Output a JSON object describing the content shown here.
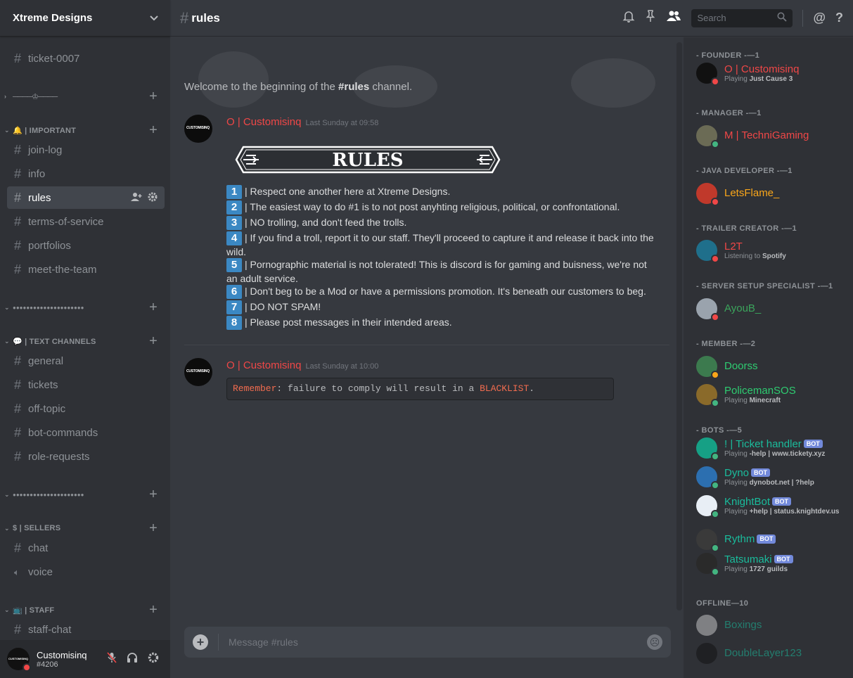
{
  "server": {
    "name": "Xtreme Designs",
    "chevron_icon": "chevron-down-icon"
  },
  "channels": {
    "top": [
      {
        "name": "ticket-0007",
        "locked": true
      }
    ],
    "categories": [
      {
        "id": "divider1",
        "label": "────♔────",
        "collapsed": true
      },
      {
        "id": "important",
        "label": "🔔 | IMPORTANT",
        "channels": [
          "join-log",
          "info",
          "rules",
          "terms-of-service",
          "portfolios",
          "meet-the-team"
        ]
      },
      {
        "id": "divider2",
        "label": "●●●●●●●●●●●●●●●●●●●●●",
        "collapsed": true
      },
      {
        "id": "text",
        "label": "💬 | TEXT CHANNELS",
        "channels": [
          "general",
          "tickets",
          "off-topic",
          "bot-commands",
          "role-requests"
        ]
      },
      {
        "id": "divider3",
        "label": "●●●●●●●●●●●●●●●●●●●●●",
        "collapsed": true
      },
      {
        "id": "sellers",
        "label": "$ | SELLERS",
        "channels": [
          "chat",
          "voice"
        ]
      },
      {
        "id": "staff",
        "label": "📺 | STAFF",
        "channels": [
          "staff-chat"
        ]
      }
    ],
    "active": "rules"
  },
  "user": {
    "name": "Customisinq",
    "tag": "#4206",
    "avatar_label": "CUSTOMISINQ",
    "status_color": "#f04747"
  },
  "topbar": {
    "channel": "rules",
    "search_placeholder": "Search",
    "icons": [
      "bell-icon",
      "pin-icon",
      "members-icon",
      "search-icon",
      "mention-icon",
      "help-icon"
    ]
  },
  "chat": {
    "welcome_prefix": "Welcome to the beginning of the ",
    "welcome_channel": "#rules",
    "welcome_suffix": " channel.",
    "messages": [
      {
        "author": "O | Customisinq",
        "time": "Last Sunday at 09:58",
        "banner_text": "RULES",
        "rules": [
          {
            "n": "1",
            "text": "| Respect one another here at Xtreme Designs."
          },
          {
            "n": "2",
            "text": "|  The easiest way to do #1 is to not post anyhting religious, political, or confrontational."
          },
          {
            "n": "3",
            "text": "| NO trolling, and don't feed the trolls."
          },
          {
            "n": "4",
            "text": "| If you find a troll, report it to our staff. They'll proceed to capture it and release it back into the wild."
          },
          {
            "n": "5",
            "text": "| Pornographic material is not tolerated! This is discord is for gaming and buisness, we're not an adult service."
          },
          {
            "n": "6",
            "text": "| Don't beg to be a Mod or have a permissions promotion. It's beneath our customers to beg."
          },
          {
            "n": "7",
            "text": "| DO NOT SPAM!"
          },
          {
            "n": "8",
            "text": "| Please post messages in their intended areas."
          }
        ]
      },
      {
        "author": "O | Customisinq",
        "time": "Last Sunday at 10:00",
        "code_kw1": "Remember",
        "code_mid": ": failure to comply will result in a ",
        "code_kw2": "BLACKLIST",
        "code_end": "."
      }
    ],
    "input_placeholder": "Message #rules"
  },
  "members": {
    "groups": [
      {
        "title": "- FOUNDER -—1",
        "members": [
          {
            "name": "O | Customisinq",
            "color": "#f04747",
            "status": "#f04747",
            "activity": "Playing ",
            "activity_b": "Just Cause 3",
            "av": "#111111"
          }
        ]
      },
      {
        "title": "- MANAGER -—1",
        "members": [
          {
            "name": "M | TechniGaming",
            "color": "#f04747",
            "status": "#43b581",
            "av": "#6b6b55"
          }
        ]
      },
      {
        "title": "- JAVA DEVELOPER -—1",
        "members": [
          {
            "name": "LetsFlame_",
            "color": "#faa61a",
            "status": "#f04747",
            "av": "#c0392b"
          }
        ]
      },
      {
        "title": "- TRAILER CREATOR -—1",
        "members": [
          {
            "name": "L2T",
            "color": "#f04747",
            "status": "#f04747",
            "activity": "Listening to ",
            "activity_b": "Spotify",
            "av": "#1f6f8b"
          }
        ]
      },
      {
        "title": "- SERVER SETUP SPECIALIST -—1",
        "members": [
          {
            "name": "AyouB_",
            "color": "#3ba55c",
            "status": "#f04747",
            "av": "#9aa3ad"
          }
        ]
      },
      {
        "title": "- MEMBER -—2",
        "members": [
          {
            "name": "Doorss",
            "color": "#2ecc71",
            "status": "#faa61a",
            "av": "#3c7a4e"
          },
          {
            "name": "PolicemanSOS",
            "color": "#2ecc71",
            "status": "#43b581",
            "activity": "Playing ",
            "activity_b": "Minecraft",
            "av": "#8a6a2a"
          }
        ]
      },
      {
        "title": "- BOTS -—5",
        "members": [
          {
            "name": "! | Ticket handler",
            "color": "#1abc9c",
            "status": "#43b581",
            "bot": "BOT",
            "activity": "Playing ",
            "activity_b": "-help | www.tickety.xyz",
            "av": "#16a085"
          },
          {
            "name": "Dyno",
            "color": "#1abc9c",
            "status": "#43b581",
            "bot": "BOT",
            "activity": "Playing ",
            "activity_b": "dynobot.net | ?help",
            "av": "#2c6fb0"
          },
          {
            "name": "KnightBot",
            "color": "#1abc9c",
            "status": "#43b581",
            "bot": "BOT",
            "activity": "Playing ",
            "activity_b": "+help | status.knightdev.us",
            "av": "#e8eef5"
          },
          {
            "name": "Rythm",
            "color": "#1abc9c",
            "status": "#43b581",
            "bot": "BOT",
            "av": "#3a3a3a"
          },
          {
            "name": "Tatsumaki",
            "color": "#1abc9c",
            "status": "#43b581",
            "bot": "BOT",
            "activity": "Playing ",
            "activity_b": "1727 guilds",
            "av": "#2a2a2a"
          }
        ]
      },
      {
        "title": "OFFLINE—10",
        "offline": true,
        "members": [
          {
            "name": "Boxings",
            "color": "#1abc9c",
            "av": "#d0d0d0"
          },
          {
            "name": "DoubleLayer123",
            "color": "#1abc9c",
            "av": "#0f0f0f"
          }
        ]
      }
    ]
  }
}
